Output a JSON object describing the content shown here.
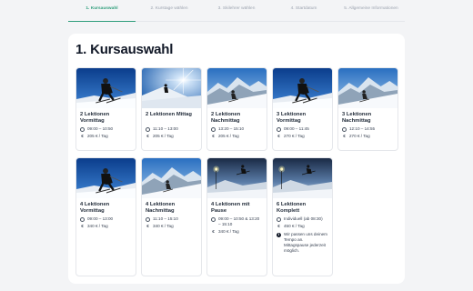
{
  "steps": [
    {
      "label": "1. Kursauswahl",
      "active": true
    },
    {
      "label": "2. Kurstage wählen",
      "active": false
    },
    {
      "label": "3. Skilehrer wählen",
      "active": false
    },
    {
      "label": "4. Startdatum",
      "active": false
    },
    {
      "label": "5. Allgemeine Informationen",
      "active": false
    }
  ],
  "page_title": "1. Kursauswahl",
  "courses": [
    {
      "title": "2 Lektionen Vormittag",
      "time": "09:00 – 10:50",
      "price": "205 € / Tag",
      "image": "blue-sky-skier"
    },
    {
      "title": "2 Lektionen Mittag",
      "time": "11:10 – 13:00",
      "price": "205 € / Tag",
      "image": "sun-skier"
    },
    {
      "title": "2 Lektionen Nachmittag",
      "time": "13:20 – 15:10",
      "price": "205 € / Tag",
      "image": "mountain-skier"
    },
    {
      "title": "3 Lektionen Vormittag",
      "time": "09:00 – 11:45",
      "price": "270 € / Tag",
      "image": "blue-sky-skier"
    },
    {
      "title": "3 Lektionen Nachmittag",
      "time": "12:10 – 14:55",
      "price": "270 € / Tag",
      "image": "mountain-skier"
    },
    {
      "title": "4 Lektionen Vormittag",
      "time": "09:00 – 13:00",
      "price": "340 € / Tag",
      "image": "blue-sky-skier"
    },
    {
      "title": "4 Lektionen Nachmittag",
      "time": "11:10 – 15:10",
      "price": "340 € / Tag",
      "image": "mountain-skier"
    },
    {
      "title": "4 Lektionen mit Pause",
      "time": "09:00 – 10:50 & 13:20 – 15:10",
      "price": "340 € / Tag",
      "image": "jump-skier"
    },
    {
      "title": "6 Lektionen Komplett",
      "time": "Individuell (ab 08:30)",
      "price": "450 € / Tag",
      "info": "Wir passen uns deinem Tempo an. Mittagspause jederzeit möglich.",
      "image": "jump-skier"
    }
  ],
  "colors": {
    "accent": "#2f9e7b",
    "sky": "#1d5fb0",
    "snow": "#eef2f7"
  }
}
